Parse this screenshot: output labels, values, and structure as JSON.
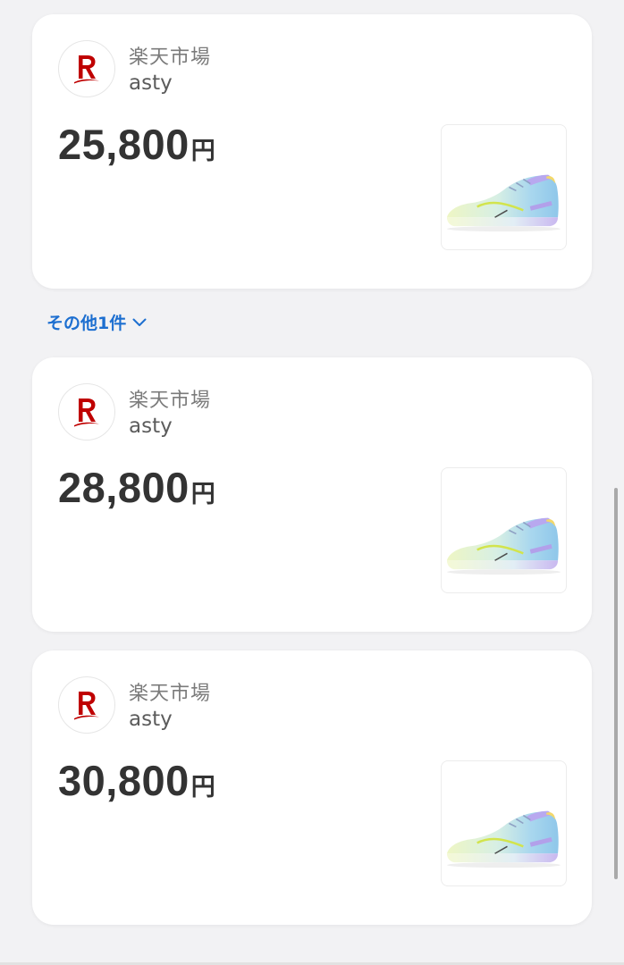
{
  "offers": [
    {
      "mall": "楽天市場",
      "shop": "asty",
      "price": "25,800",
      "currency": "円",
      "logo_icon": "rakuten-r-icon",
      "image": "sneaker-image"
    },
    {
      "mall": "楽天市場",
      "shop": "asty",
      "price": "28,800",
      "currency": "円",
      "logo_icon": "rakuten-r-icon",
      "image": "sneaker-image"
    },
    {
      "mall": "楽天市場",
      "shop": "asty",
      "price": "30,800",
      "currency": "円",
      "logo_icon": "rakuten-r-icon",
      "image": "sneaker-image"
    }
  ],
  "more_toggle": {
    "label": "その他1件",
    "icon": "chevron-down-icon"
  },
  "colors": {
    "brand_red": "#bf0000",
    "link_blue": "#1d6fd0",
    "price_text": "#333333",
    "background": "#f2f2f4"
  }
}
